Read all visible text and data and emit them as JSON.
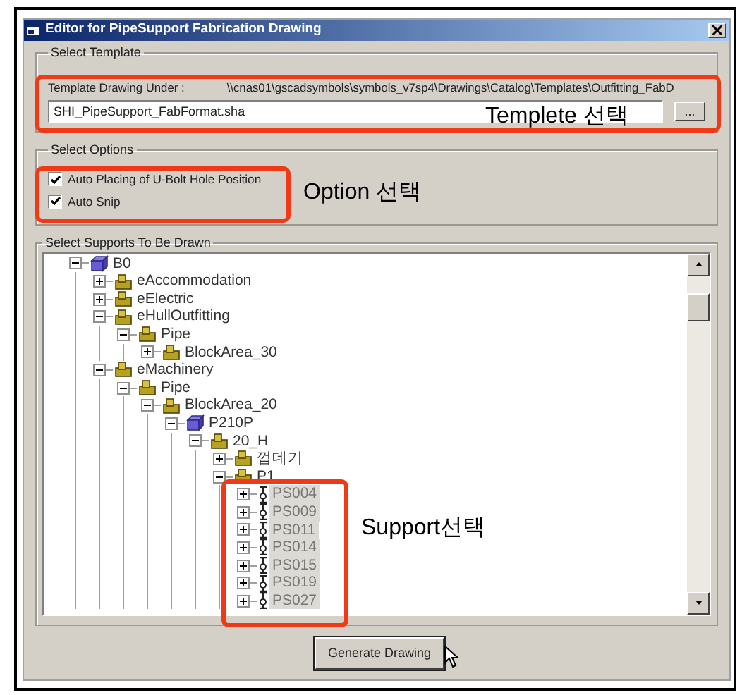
{
  "window": {
    "title": "Editor for PipeSupport Fabrication Drawing"
  },
  "template": {
    "group_label": "Select Template",
    "path_label": "Template Drawing Under :",
    "path": "\\\\cnas01\\gscadsymbols\\symbols_v7sp4\\Drawings\\Catalog\\Templates\\Outfitting_FabD",
    "file": "SHI_PipeSupport_FabFormat.sha",
    "browse_button": "..."
  },
  "options": {
    "group_label": "Select Options",
    "items": [
      {
        "label": "Auto Placing of U-Bolt Hole Position",
        "checked": true
      },
      {
        "label": "Auto Snip",
        "checked": true
      }
    ]
  },
  "supports": {
    "group_label": "Select Supports To Be Drawn",
    "tree": [
      {
        "label": "B0",
        "kind": "assembly",
        "expanded": true,
        "selected": false,
        "children": [
          {
            "label": "eAccommodation",
            "kind": "system",
            "expanded": false,
            "selected": false
          },
          {
            "label": "eElectric",
            "kind": "system",
            "expanded": false,
            "selected": false
          },
          {
            "label": "eHullOutfitting",
            "kind": "system",
            "expanded": true,
            "selected": false,
            "children": [
              {
                "label": "Pipe",
                "kind": "system",
                "expanded": true,
                "selected": false,
                "children": [
                  {
                    "label": "BlockArea_30",
                    "kind": "system",
                    "expanded": false,
                    "selected": false
                  }
                ]
              }
            ]
          },
          {
            "label": "eMachinery",
            "kind": "system",
            "expanded": true,
            "selected": false,
            "children": [
              {
                "label": "Pipe",
                "kind": "system",
                "expanded": true,
                "selected": false,
                "children": [
                  {
                    "label": "BlockArea_20",
                    "kind": "system",
                    "expanded": true,
                    "selected": false,
                    "children": [
                      {
                        "label": "P210P",
                        "kind": "assembly",
                        "expanded": true,
                        "selected": false,
                        "children": [
                          {
                            "label": "20_H",
                            "kind": "system",
                            "expanded": true,
                            "selected": false,
                            "children": [
                              {
                                "label": "껍데기",
                                "kind": "system",
                                "expanded": false,
                                "selected": false
                              },
                              {
                                "label": "P1",
                                "kind": "system",
                                "expanded": true,
                                "selected": false,
                                "children": [
                                  {
                                    "label": "PS004",
                                    "kind": "support",
                                    "expanded": false,
                                    "selected": true
                                  },
                                  {
                                    "label": "PS009",
                                    "kind": "support",
                                    "expanded": false,
                                    "selected": true
                                  },
                                  {
                                    "label": "PS011",
                                    "kind": "support",
                                    "expanded": false,
                                    "selected": true
                                  },
                                  {
                                    "label": "PS014",
                                    "kind": "support",
                                    "expanded": false,
                                    "selected": true
                                  },
                                  {
                                    "label": "PS015",
                                    "kind": "support",
                                    "expanded": false,
                                    "selected": true
                                  },
                                  {
                                    "label": "PS019",
                                    "kind": "support",
                                    "expanded": false,
                                    "selected": true
                                  },
                                  {
                                    "label": "PS027",
                                    "kind": "support",
                                    "expanded": false,
                                    "selected": true
                                  }
                                ]
                              }
                            ]
                          }
                        ]
                      }
                    ]
                  }
                ]
              }
            ]
          }
        ]
      }
    ]
  },
  "generate_button": "Generate Drawing",
  "annotations": [
    {
      "text": "Templete  선택"
    },
    {
      "text": "Option  선택"
    },
    {
      "text": "Support선택"
    }
  ]
}
